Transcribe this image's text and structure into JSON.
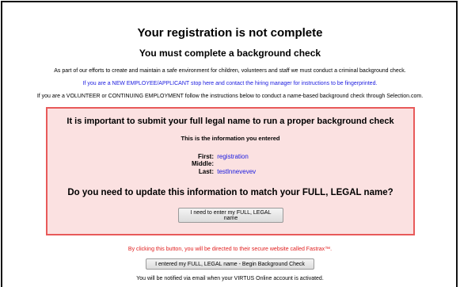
{
  "title": "Your registration is not complete",
  "subtitle": "You must complete a background check",
  "intro": "As part of our efforts to create and maintain a safe environment for children, volunteers and staff we must conduct a criminal background check.",
  "new_employee_note": "If you are a NEW EMPLOYEE/APPLICANT stop here and contact the hiring manager for instructions to be fingerprinted.",
  "volunteer_note": "If you are a VOLUNTEER or CONTINUING EMPLOYMENT follow the instructions below to conduct a name-based background check through Selection.com.",
  "box": {
    "heading": "It is important to submit your full legal name to run a proper background check",
    "info_label": "This is the information you entered",
    "fields": {
      "first_label": "First:",
      "first_value": "registration",
      "middle_label": "Middle:",
      "middle_value": "",
      "last_label": "Last:",
      "last_value": "testlnnevevev"
    },
    "question": "Do you need to update this information to match your FULL, LEGAL name?",
    "update_button": "I need to enter my FULL, LEGAL name"
  },
  "click_note": "By clicking this button, you will be directed to their secure website called Fastrax™.",
  "begin_button": "I entered my FULL, LEGAL name - Begin Background Check",
  "notify_note": "You will be notified via email when your VIRTUS Online account is activated.",
  "colors": {
    "link_blue": "#1a1adf",
    "warning_red": "#e12020",
    "box_bg": "#fbe1e1",
    "box_border": "#e85a5a"
  }
}
